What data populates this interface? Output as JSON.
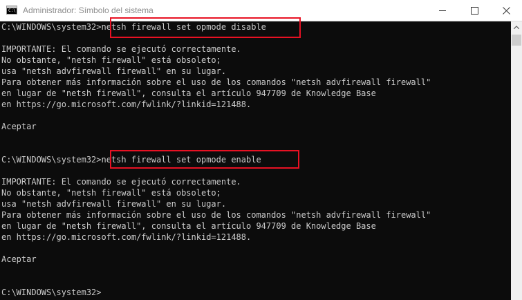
{
  "window": {
    "title": "Administrador: Símbolo del sistema",
    "icon": "cmd-icon",
    "controls": [
      "minimize-icon",
      "maximize-icon",
      "close-icon"
    ]
  },
  "console": {
    "lines": [
      "C:\\WINDOWS\\system32>netsh firewall set opmode disable",
      "",
      "IMPORTANTE: El comando se ejecutó correctamente.",
      "No obstante, \"netsh firewall\" está obsoleto;",
      "usa \"netsh advfirewall firewall\" en su lugar.",
      "Para obtener más información sobre el uso de los comandos \"netsh advfirewall firewall\"",
      "en lugar de \"netsh firewall\", consulta el artículo 947709 de Knowledge Base",
      "en https://go.microsoft.com/fwlink/?linkid=121488.",
      "",
      "Aceptar",
      "",
      "",
      "C:\\WINDOWS\\system32>netsh firewall set opmode enable",
      "",
      "IMPORTANTE: El comando se ejecutó correctamente.",
      "No obstante, \"netsh firewall\" está obsoleto;",
      "usa \"netsh advfirewall firewall\" en su lugar.",
      "Para obtener más información sobre el uso de los comandos \"netsh advfirewall firewall\"",
      "en lugar de \"netsh firewall\", consulta el artículo 947709 de Knowledge Base",
      "en https://go.microsoft.com/fwlink/?linkid=121488.",
      "",
      "Aceptar",
      "",
      "",
      "C:\\WINDOWS\\system32>"
    ]
  },
  "colors": {
    "console_bg": "#0c0c0c",
    "console_text": "#cccccc",
    "highlight": "#e81123"
  }
}
